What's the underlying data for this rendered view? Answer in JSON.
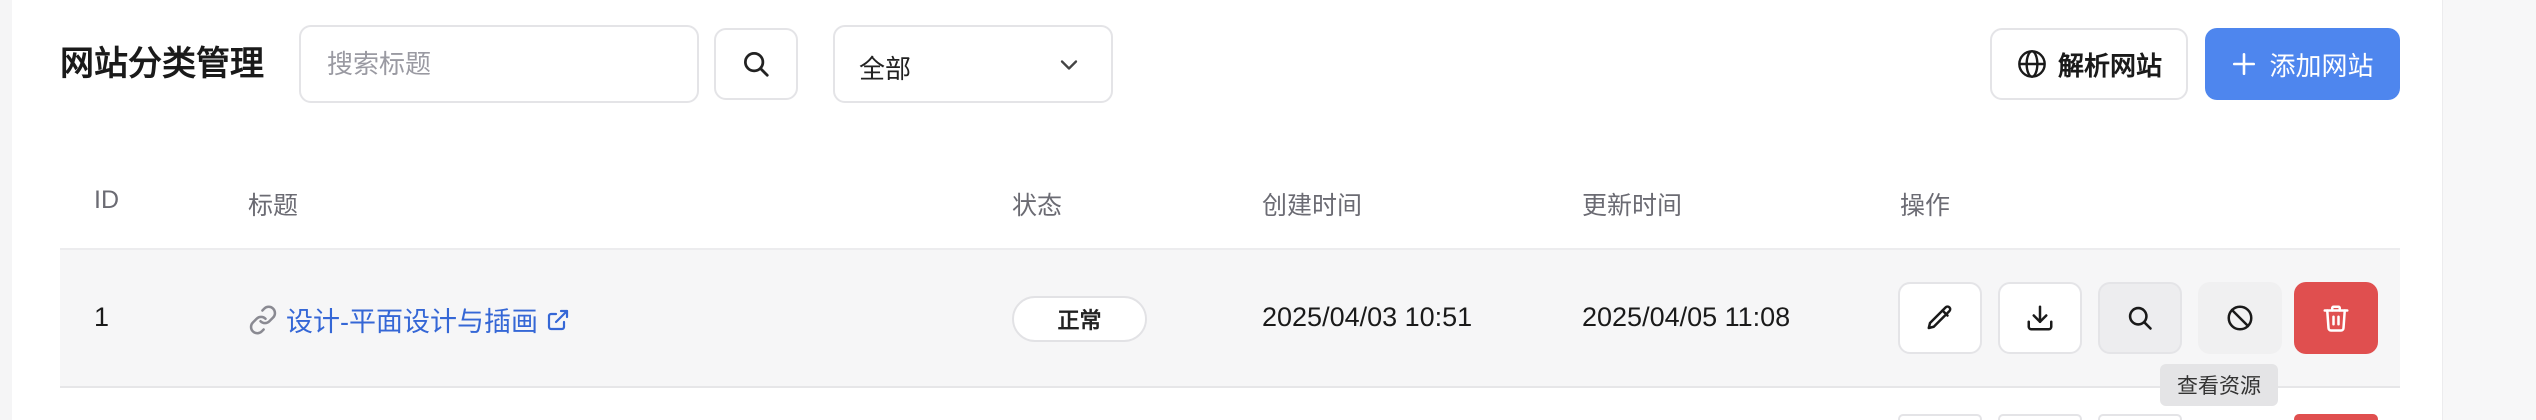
{
  "page": {
    "title": "网站分类管理"
  },
  "search": {
    "placeholder": "搜索标题",
    "value": ""
  },
  "filter": {
    "selected": "全部"
  },
  "toolbar": {
    "parse_label": "解析网站",
    "add_label": "添加网站"
  },
  "table": {
    "columns": [
      "ID",
      "标题",
      "状态",
      "创建时间",
      "更新时间",
      "操作"
    ],
    "rows": [
      {
        "id": "1",
        "title": "设计-平面设计与插画",
        "status": "正常",
        "created": "2025/04/03 10:51",
        "updated": "2025/04/05 11:08"
      }
    ]
  },
  "tooltip": {
    "text": "查看资源"
  },
  "colors": {
    "accent": "#4e86ee",
    "link": "#3567d6",
    "danger": "#e04f4f"
  },
  "icons": {
    "search": "search-icon",
    "dropdown": "chevron-down-icon",
    "parse": "globe-icon",
    "add": "plus-icon",
    "link": "link-icon",
    "external": "external-link-icon",
    "edit": "pencil-icon",
    "download": "download-icon",
    "view": "search-icon",
    "disable": "ban-icon",
    "delete": "trash-icon"
  }
}
